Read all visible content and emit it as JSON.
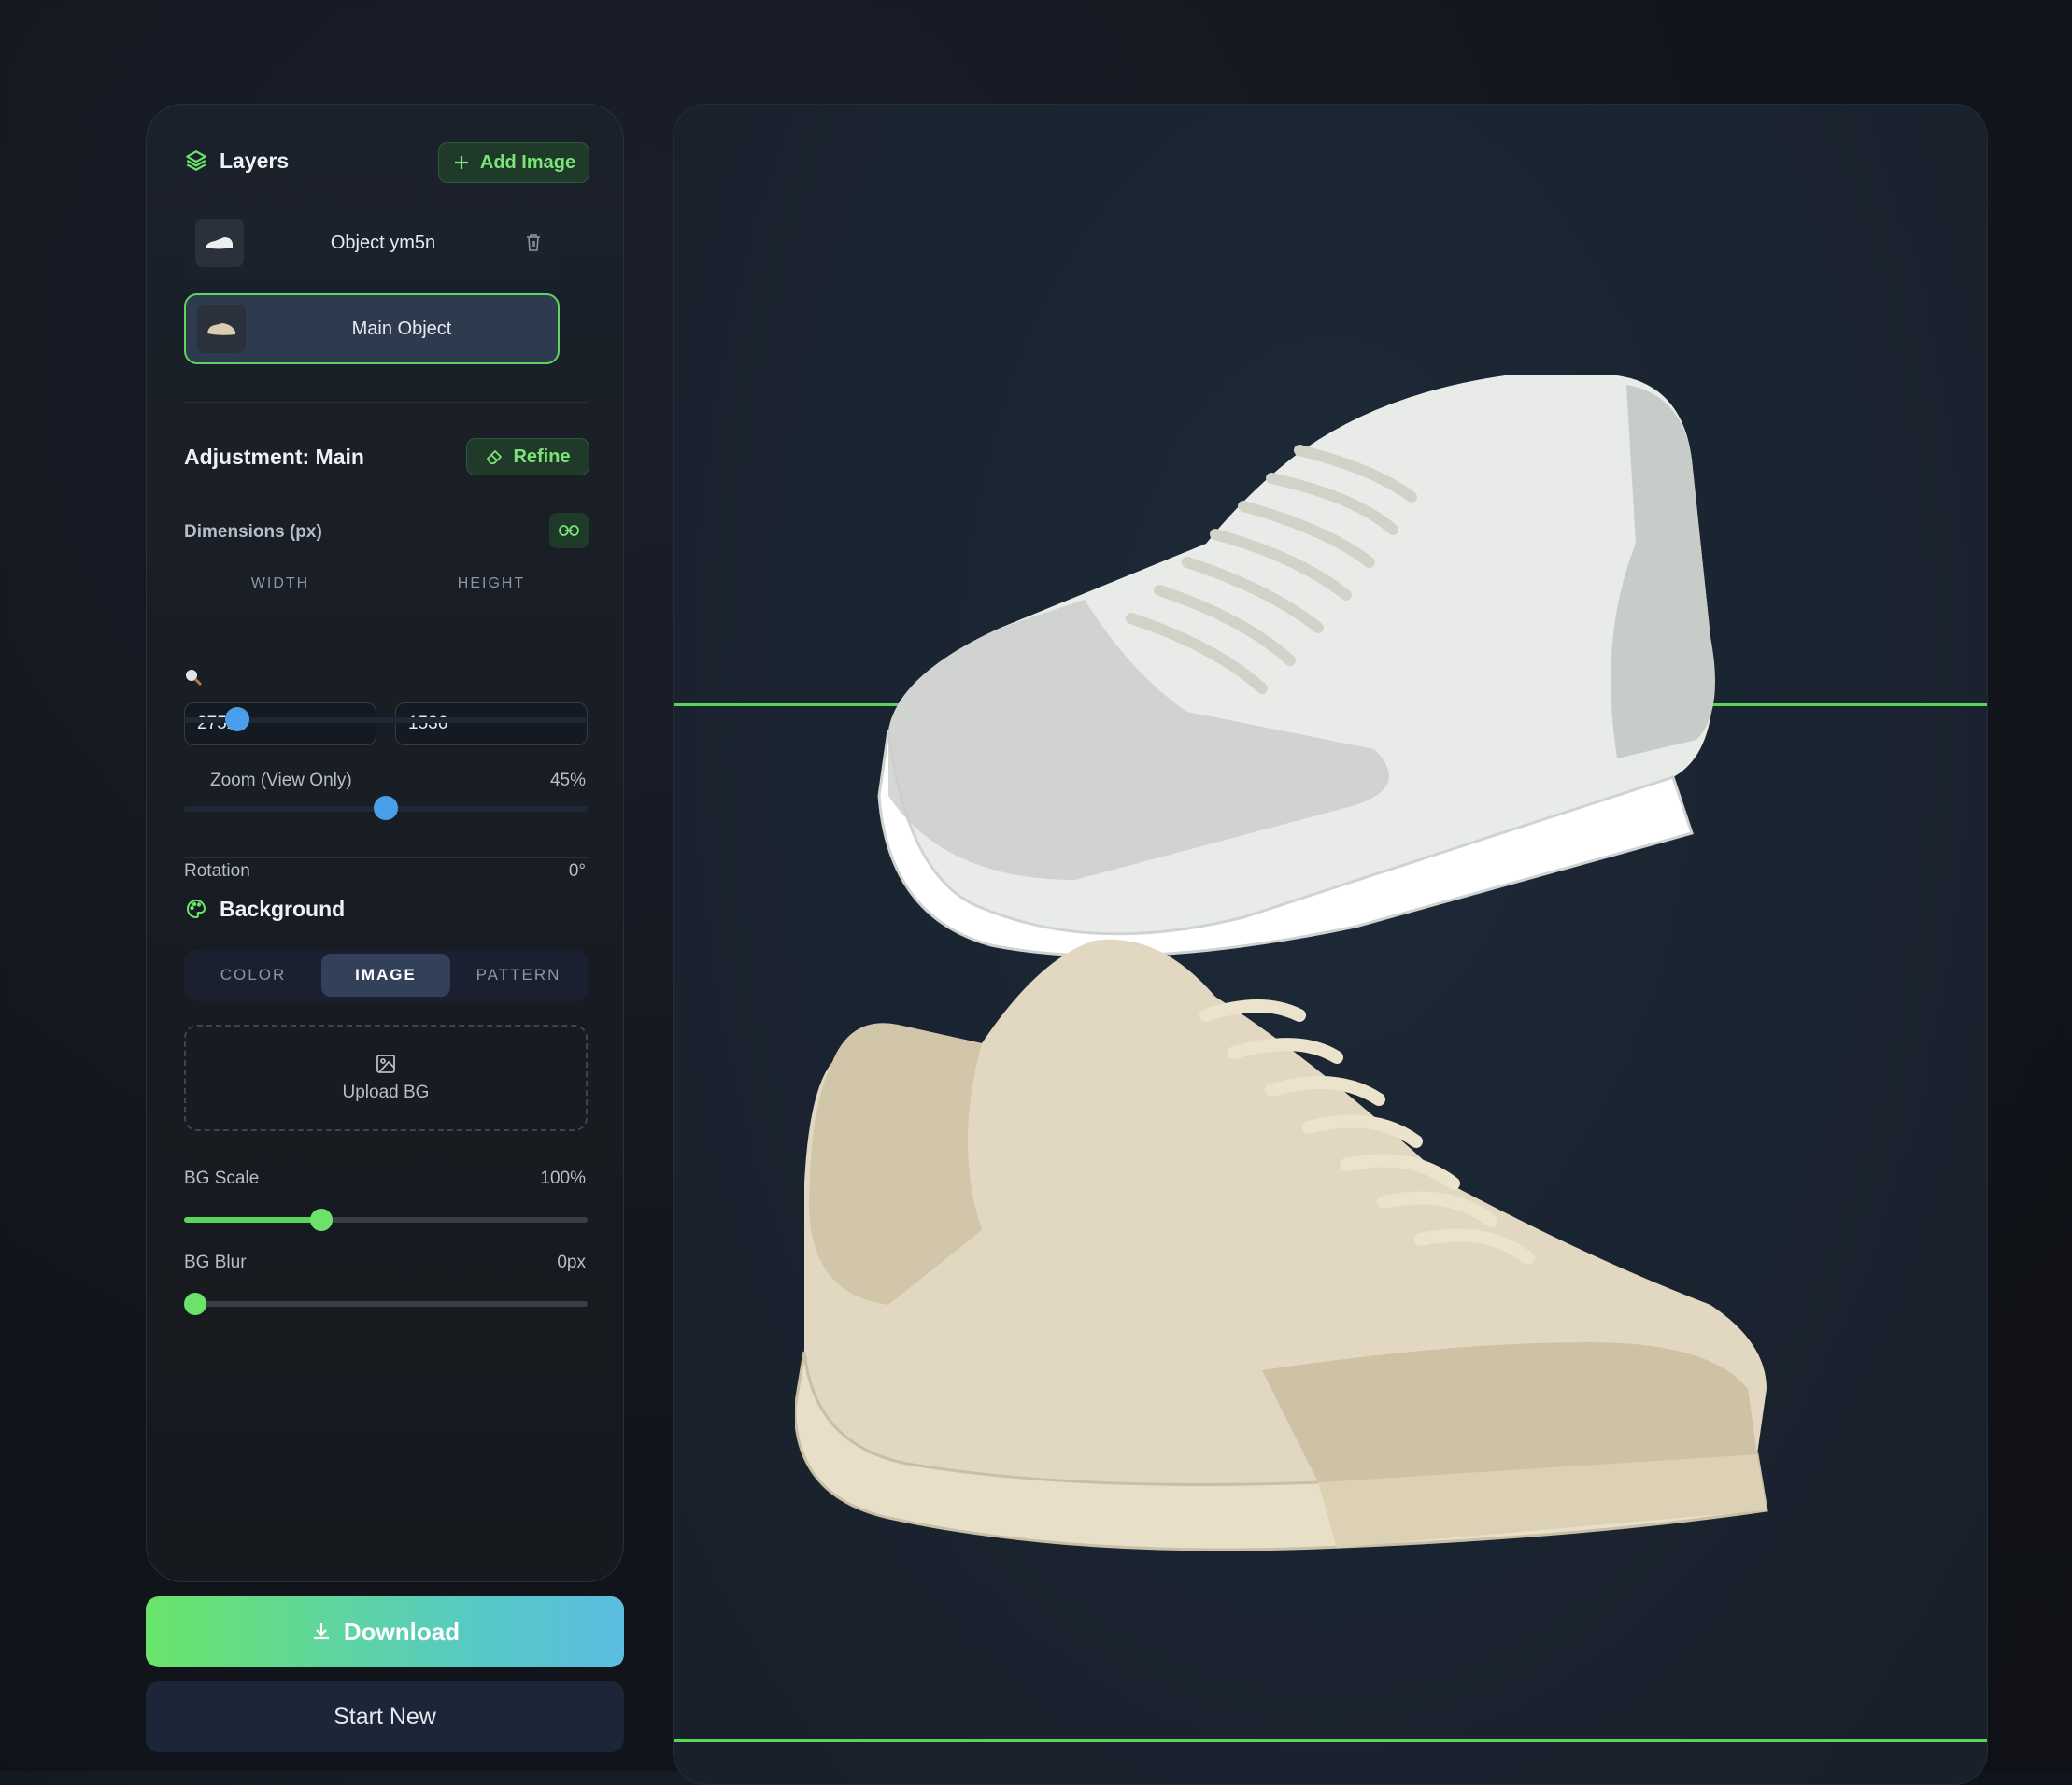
{
  "layers": {
    "title": "Layers",
    "add_image_label": "Add Image",
    "items": [
      {
        "name": "Object ym5n"
      },
      {
        "name": "Main Object"
      }
    ]
  },
  "adjustment": {
    "title": "Adjustment: Main",
    "refine_label": "Refine",
    "dimensions_label": "Dimensions (px)",
    "width_label": "WIDTH",
    "height_label": "HEIGHT",
    "width_value": "2752",
    "height_value": "1536",
    "zoom_label": "Zoom (View Only)",
    "zoom_value": "45%",
    "zoom_fraction": 0.14,
    "rotation_label": "Rotation",
    "rotation_value": "0°",
    "rotation_fraction": 0.5
  },
  "background": {
    "title": "Background",
    "tabs": [
      "COLOR",
      "IMAGE",
      "PATTERN"
    ],
    "active_tab": "IMAGE",
    "upload_label": "Upload BG",
    "bg_scale_label": "BG Scale",
    "bg_scale_value": "100%",
    "bg_scale_fraction": 0.34,
    "bg_blur_label": "BG Blur",
    "bg_blur_value": "0px",
    "bg_blur_fraction": 0.0
  },
  "actions": {
    "download_label": "Download",
    "start_new_label": "Start New"
  },
  "colors": {
    "accent_green": "#6be36b",
    "slider_blue": "#4a9fea",
    "panel_bg": "#1b212b"
  }
}
